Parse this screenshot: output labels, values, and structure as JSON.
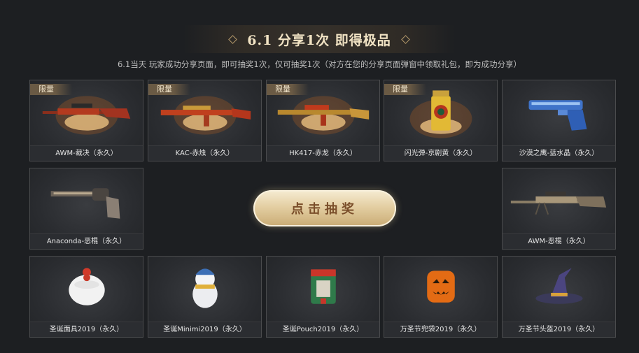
{
  "header": {
    "title": "6.1 分享1次 即得极品",
    "subtitle": "6.1当天 玩家成功分享页面，即可抽奖1次，仅可抽奖1次（对方在您的分享页面弹窗中领取礼包，即为成功分享）"
  },
  "draw_button": {
    "label": "点击抽奖"
  },
  "badge_text": "限量",
  "items": [
    {
      "label": "AWM-裁决（永久）",
      "limited": true,
      "icon": "sniper-rifle-red-icon"
    },
    {
      "label": "KAC-赤烛（永久）",
      "limited": true,
      "icon": "rifle-gold-red-icon"
    },
    {
      "label": "HK417-赤龙（永久）",
      "limited": true,
      "icon": "rifle-gold-dragon-icon"
    },
    {
      "label": "闪光弹-京剧黄（永久）",
      "limited": true,
      "icon": "flashbang-opera-icon"
    },
    {
      "label": "沙漠之鹰-蓝水晶（永久）",
      "limited": false,
      "icon": "pistol-blue-crystal-icon"
    },
    {
      "label": "Anaconda-恶棍（永久）",
      "limited": false,
      "icon": "revolver-icon"
    },
    {
      "label": "AWM-恶棍（永久）",
      "limited": false,
      "icon": "sniper-rifle-icon"
    },
    {
      "label": "圣诞面具2019（永久）",
      "limited": false,
      "icon": "santa-mask-icon"
    },
    {
      "label": "圣诞Minimi2019（永久）",
      "limited": false,
      "icon": "snowman-icon"
    },
    {
      "label": "圣诞Pouch2019（永久）",
      "limited": false,
      "icon": "pouch-icon"
    },
    {
      "label": "万圣节兜袋2019（永久）",
      "limited": false,
      "icon": "pumpkin-bag-icon"
    },
    {
      "label": "万圣节头盔2019（永久）",
      "limited": false,
      "icon": "witch-hat-icon"
    }
  ]
}
